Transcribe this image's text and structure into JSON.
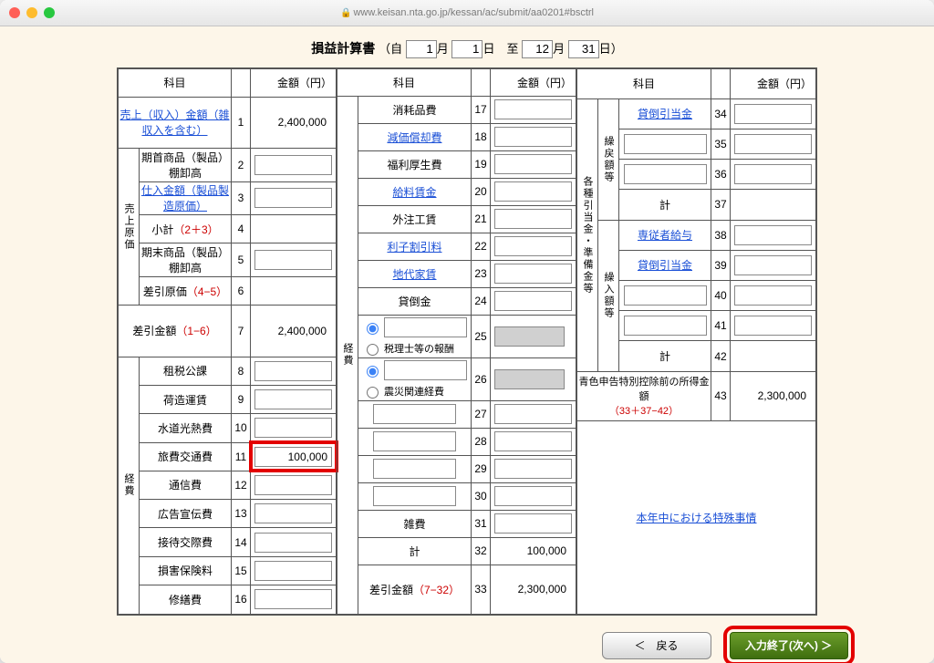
{
  "browser": {
    "url": "www.keisan.nta.go.jp/kessan/ac/submit/aa0201#bsctrl"
  },
  "header": {
    "title": "損益計算書",
    "period_prefix": "（自",
    "from_month": "1",
    "from_day": "1",
    "period_mid": "日　至",
    "to_month": "12",
    "to_day": "31",
    "period_suffix": "日）",
    "m": "月",
    "d": "日"
  },
  "col_heads": {
    "kamoku": "科目",
    "amount": "金額（円）"
  },
  "section1": {
    "group": "売上原価",
    "row1": {
      "label": "売上（収入）金額（雑収入を含む）",
      "num": "1",
      "value": "2,400,000",
      "link": true
    },
    "row2": {
      "label": "期首商品（製品）棚卸高",
      "num": "2"
    },
    "row3": {
      "label": "仕入金額（製品製造原価）",
      "num": "3",
      "link": true
    },
    "row4": {
      "label": "小計（2＋3）",
      "num": "4",
      "red": "（2＋3）"
    },
    "row5": {
      "label": "期末商品（製品）棚卸高",
      "num": "5"
    },
    "row6": {
      "label": "差引原価（4−5）",
      "num": "6",
      "red": "（4−5）"
    },
    "row7": {
      "label": "差引金額（1−6）",
      "num": "7",
      "red": "（1−6）",
      "value": "2,400,000"
    }
  },
  "section2": {
    "group": "経費",
    "rows": [
      {
        "label": "租税公課",
        "num": "8"
      },
      {
        "label": "荷造運賃",
        "num": "9"
      },
      {
        "label": "水道光熱費",
        "num": "10"
      },
      {
        "label": "旅費交通費",
        "num": "11",
        "value": "100,000",
        "highlight": true
      },
      {
        "label": "通信費",
        "num": "12"
      },
      {
        "label": "広告宣伝費",
        "num": "13"
      },
      {
        "label": "接待交際費",
        "num": "14"
      },
      {
        "label": "損害保険料",
        "num": "15"
      },
      {
        "label": "修繕費",
        "num": "16"
      }
    ]
  },
  "section3": {
    "group": "経費",
    "rows": [
      {
        "label": "消耗品費",
        "num": "17"
      },
      {
        "label": "減価償却費",
        "num": "18",
        "link": true
      },
      {
        "label": "福利厚生費",
        "num": "19"
      },
      {
        "label": "給料賃金",
        "num": "20",
        "link": true
      },
      {
        "label": "外注工賃",
        "num": "21"
      },
      {
        "label": "利子割引料",
        "num": "22",
        "link": true
      },
      {
        "label": "地代家賃",
        "num": "23",
        "link": true
      },
      {
        "label": "貸倒金",
        "num": "24"
      }
    ],
    "radio25": {
      "num": "25",
      "opt": "税理士等の報酬",
      "disabled": true
    },
    "radio26": {
      "num": "26",
      "opt": "震災関連経費",
      "disabled": true
    },
    "free": [
      {
        "num": "27"
      },
      {
        "num": "28"
      },
      {
        "num": "29"
      },
      {
        "num": "30"
      }
    ],
    "misc": {
      "label": "雑費",
      "num": "31"
    },
    "total": {
      "label": "計",
      "num": "32",
      "value": "100,000"
    },
    "diff": {
      "label": "差引金額（7−32）",
      "red": "（7−32）",
      "num": "33",
      "value": "2,300,000"
    }
  },
  "section4": {
    "group1": "各種引当金・準備金等",
    "sub1": "繰戻額等",
    "sub2": "繰入額等",
    "rows1": [
      {
        "label": "貸倒引当金",
        "num": "34",
        "link": true
      },
      {
        "label": "",
        "num": "35"
      },
      {
        "label": "",
        "num": "36"
      },
      {
        "label": "計",
        "num": "37"
      }
    ],
    "rows2": [
      {
        "label": "専従者給与",
        "num": "38",
        "link": true
      },
      {
        "label": "貸倒引当金",
        "num": "39",
        "link": true
      },
      {
        "label": "",
        "num": "40"
      },
      {
        "label": "",
        "num": "41"
      },
      {
        "label": "計",
        "num": "42"
      }
    ],
    "final": {
      "label": "青色申告特別控除前の所得金額",
      "red": "（33＋37−42）",
      "num": "43",
      "value": "2,300,000"
    },
    "note": {
      "label": "本年中における特殊事情",
      "link": true
    }
  },
  "buttons": {
    "back": "＜　戻る",
    "next": "入力終了(次へ) ＞"
  }
}
